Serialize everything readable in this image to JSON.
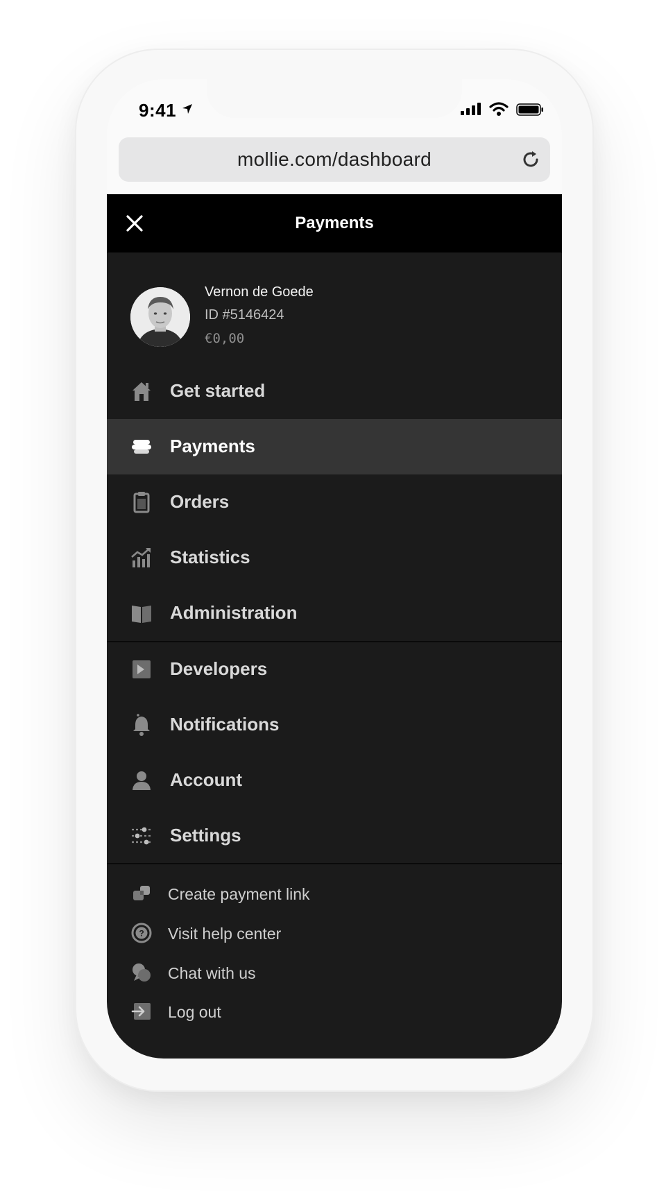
{
  "status_bar": {
    "time": "9:41"
  },
  "browser": {
    "url": "mollie.com/dashboard"
  },
  "header": {
    "title": "Payments"
  },
  "profile": {
    "name": "Vernon de Goede",
    "id": "ID #5146424",
    "balance": "€0,00"
  },
  "menu": {
    "primary": [
      {
        "label": "Get started",
        "icon": "home-icon"
      },
      {
        "label": "Payments",
        "icon": "payments-icon",
        "active": true
      },
      {
        "label": "Orders",
        "icon": "clipboard-icon"
      },
      {
        "label": "Statistics",
        "icon": "chart-icon"
      },
      {
        "label": "Administration",
        "icon": "book-icon"
      }
    ],
    "secondary": [
      {
        "label": "Developers",
        "icon": "terminal-icon"
      },
      {
        "label": "Notifications",
        "icon": "bell-icon"
      },
      {
        "label": "Account",
        "icon": "user-icon"
      },
      {
        "label": "Settings",
        "icon": "sliders-icon"
      }
    ],
    "footer": [
      {
        "label": "Create payment link",
        "icon": "link-icon"
      },
      {
        "label": "Visit help center",
        "icon": "help-icon"
      },
      {
        "label": "Chat with us",
        "icon": "chat-icon"
      },
      {
        "label": "Log out",
        "icon": "logout-icon"
      }
    ]
  },
  "colors": {
    "menu_bg": "#1b1b1b",
    "header_bg": "#000000",
    "active_bg": "#353535"
  }
}
